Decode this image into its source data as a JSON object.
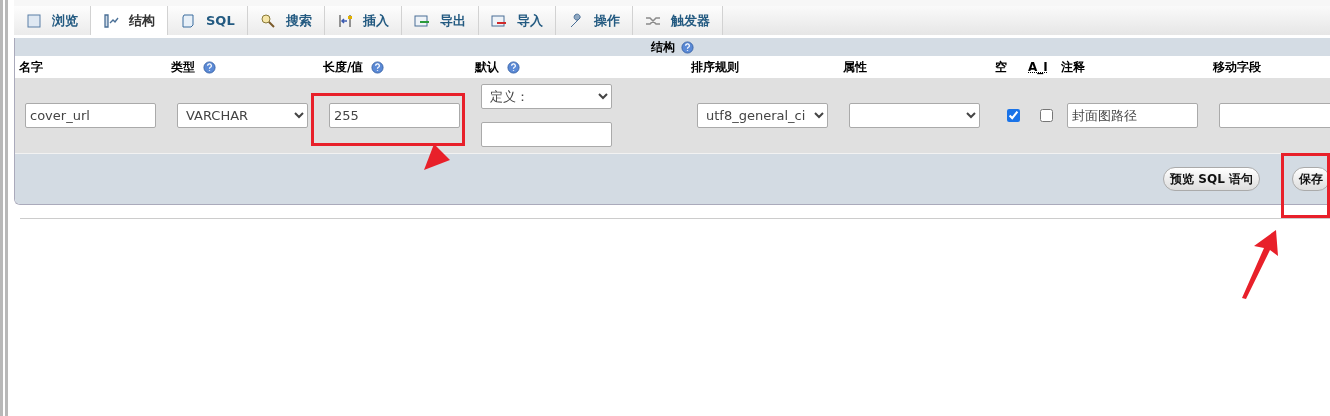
{
  "tabs": [
    {
      "label": "浏览",
      "selected": false
    },
    {
      "label": "结构",
      "selected": true
    },
    {
      "label": "SQL",
      "selected": false
    },
    {
      "label": "搜索",
      "selected": false
    },
    {
      "label": "插入",
      "selected": false
    },
    {
      "label": "导出",
      "selected": false
    },
    {
      "label": "导入",
      "selected": false
    },
    {
      "label": "操作",
      "selected": false
    },
    {
      "label": "触发器",
      "selected": false
    }
  ],
  "section_title": "结构",
  "columns": [
    {
      "label": "名字",
      "kind": "plain"
    },
    {
      "label": "类型",
      "kind": "help"
    },
    {
      "label": "长度/值",
      "kind": "help"
    },
    {
      "label": "默认",
      "kind": "help"
    },
    {
      "label": "排序规则",
      "kind": "plain"
    },
    {
      "label": "属性",
      "kind": "plain"
    },
    {
      "label": "空",
      "kind": "plain"
    },
    {
      "label": "A_I",
      "kind": "plain"
    },
    {
      "label": "注释",
      "kind": "plain"
    },
    {
      "label": "移动字段",
      "kind": "plain"
    }
  ],
  "field": {
    "name": "cover_url",
    "type": "VARCHAR",
    "length": "255",
    "default_kind": "定义：",
    "collation": "utf8_general_ci",
    "null_checked": true,
    "ai_checked": false,
    "comment": "封面图路径"
  },
  "buttons": [
    "预览 SQL 语句",
    "保存"
  ]
}
